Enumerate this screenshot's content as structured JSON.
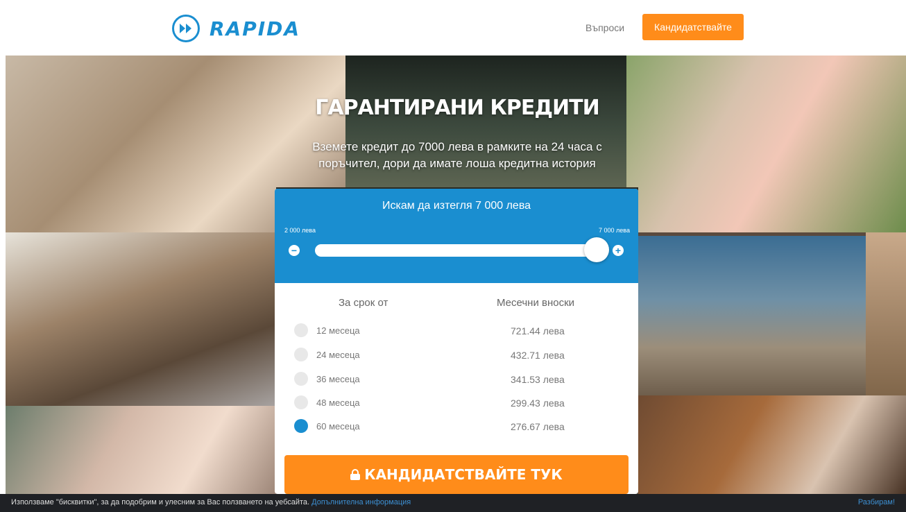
{
  "header": {
    "brand": "RAPIDA",
    "nav_questions": "Въпроси",
    "nav_apply": "Кандидатствайте"
  },
  "hero": {
    "title": "ГАРАНТИРАНИ КРЕДИТИ",
    "subtitle": "Вземете кредит до 7000 лева в рамките на 24 часа с поръчител, дори да имате лоша кредитна история"
  },
  "calculator": {
    "heading": "Искам да изтегля 7 000 лева",
    "range_min": "2 000 лева",
    "range_max": "7 000 лева",
    "slider_fraction": 1.0,
    "col_term": "За срок от",
    "col_monthly": "Месечни вноски",
    "options": [
      {
        "term": "12 месеца",
        "payment": "721.44 лева",
        "selected": false
      },
      {
        "term": "24 месеца",
        "payment": "432.71 лева",
        "selected": false
      },
      {
        "term": "36 месеца",
        "payment": "341.53 лева",
        "selected": false
      },
      {
        "term": "48 месеца",
        "payment": "299.43 лева",
        "selected": false
      },
      {
        "term": "60 месеца",
        "payment": "276.67 лева",
        "selected": true
      }
    ],
    "apply_button": "КАНДИДАТСТВАЙТЕ ТУК"
  },
  "cookie_bar": {
    "text": "Използваме \"бисквитки\", за да подобрим и улесним за Вас ползването на уебсайта.",
    "more_link": "Допълнителна информация",
    "accept": "Разбирам!"
  },
  "colors": {
    "brand_blue": "#1a8ed0",
    "accent_orange": "#ff8c1a",
    "cookie_bg": "#1f2125"
  },
  "icons": [
    "rapida-logo-icon",
    "minus-icon",
    "plus-icon",
    "lock-icon"
  ]
}
